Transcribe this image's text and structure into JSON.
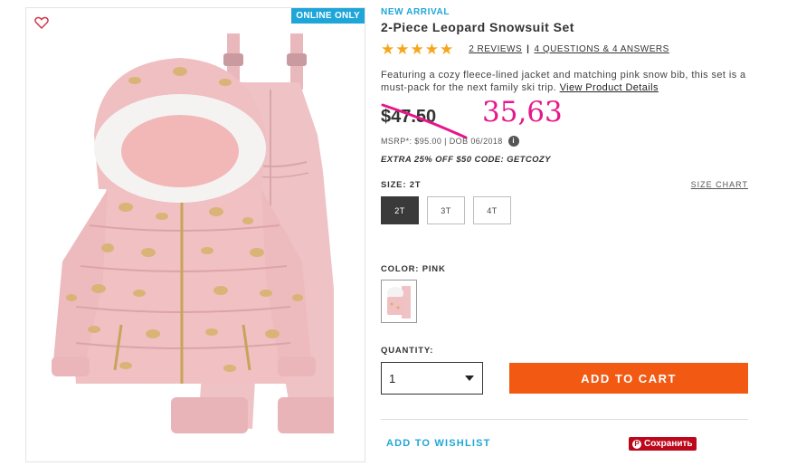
{
  "image": {
    "badge": "ONLINE ONLY",
    "wishlist_icon": "heart-icon"
  },
  "product": {
    "tag": "NEW ARRIVAL",
    "title": "2-Piece Leopard Snowsuit Set",
    "rating": 5,
    "rating_stars": "★★★★★",
    "reviews_label": "2 REVIEWS",
    "separator": "|",
    "qa_label": "4 QUESTIONS & 4 ANSWERS",
    "description": "Featuring a cozy fleece-lined jacket and matching pink snow bib, this set is a must-pack for the next family ski trip.",
    "view_details": "View Product Details",
    "price": "$47.50",
    "handwritten_price": "35,63",
    "msrp": "MSRP*: $95.00 | DOB 06/2018",
    "info_icon": "i",
    "promo": "EXTRA 25% OFF $50 CODE: GETCOZY"
  },
  "size": {
    "label": "SIZE: 2T",
    "chart_link": "SIZE CHART",
    "options": [
      "2T",
      "3T",
      "4T"
    ],
    "selected": "2T"
  },
  "color": {
    "label": "COLOR: PINK",
    "selected": "PINK"
  },
  "quantity": {
    "label": "QUANTITY:",
    "value": "1"
  },
  "actions": {
    "add_to_cart": "ADD TO CART",
    "wishlist": "ADD TO WISHLIST",
    "pin_save": "Сохранить",
    "pin_icon": "P"
  },
  "colors": {
    "accent_blue": "#1fa6d9",
    "cta_orange": "#f25a13",
    "star_gold": "#f7a61c",
    "handwritten_pink": "#e6178a",
    "pinterest_red": "#bd081c",
    "selected_size": "#3a3a3a"
  }
}
